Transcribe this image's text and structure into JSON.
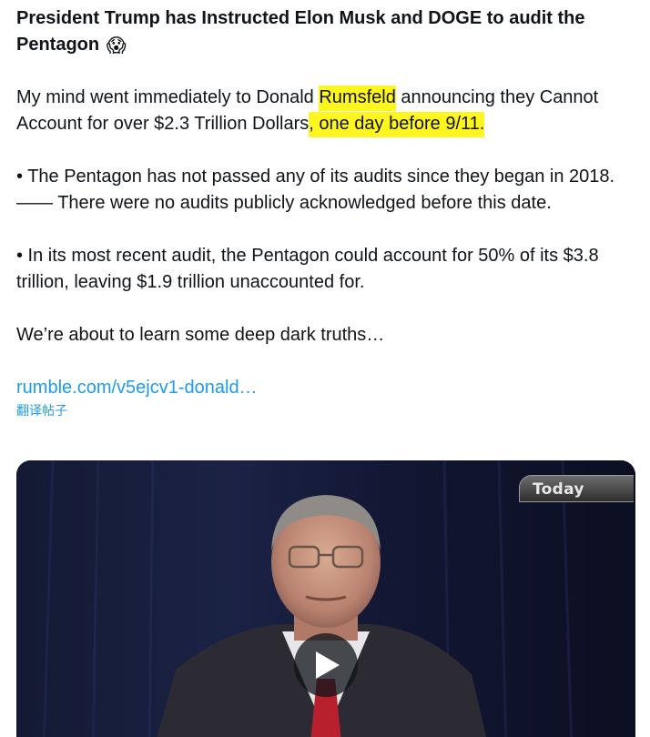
{
  "post": {
    "title": "President Trump has Instructed Elon Musk and DOGE to audit the Pentagon",
    "title_emoji": "😱",
    "p1_a": "My mind went immediately to Donald ",
    "p1_highlight_1": "Rumsfeld",
    "p1_b": " announcing they Cannot Account for over $2.3 Trillion Dollars",
    "p1_highlight_2": ", one day before 9/11.",
    "p2_a": "• The Pentagon has not passed any of its audits since they began in 2018.",
    "p2_b": "—— There were no audits publicly acknowledged before this date.",
    "p3": "• In its most recent audit, the Pentagon could account for 50% of its $3.8 trillion, leaving $1.9 trillion unaccounted for.",
    "p4": "We’re about to learn some deep dark truths…",
    "link_text": "rumble.com/v5ejcv1-donald…",
    "translate_label": "翻译帖子"
  },
  "video": {
    "channel_badge": "Today",
    "play_icon": "play-icon",
    "highlight_color": "#fff51f",
    "link_color": "#1d9bf0"
  }
}
